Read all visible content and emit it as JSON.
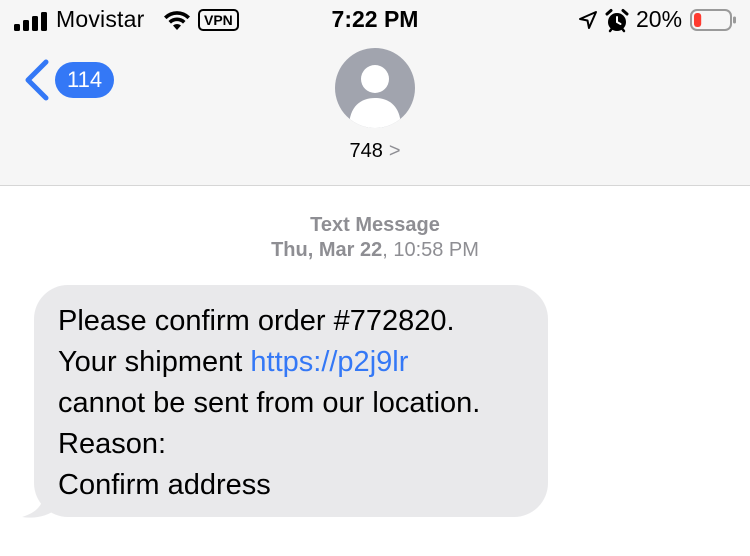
{
  "status_bar": {
    "carrier": "Movistar",
    "vpn": "VPN",
    "time": "7:22 PM",
    "battery_percent": "20%",
    "battery_level": 0.2,
    "battery_color": "#ff3b30"
  },
  "nav": {
    "back_count": "114",
    "contact": "748",
    "contact_chevron": ">"
  },
  "thread": {
    "message_type": "Text Message",
    "date": "Thu, Mar 22",
    "time": ", 10:58 PM"
  },
  "message": {
    "line1": "Please confirm order #772820.",
    "line2_prefix": "Your shipment ",
    "line2_link": "https://p2j9lr",
    "line3": "cannot be sent from our location.",
    "line4": "Reason:",
    "line5": "Confirm address"
  },
  "colors": {
    "accent": "#3478f6",
    "bubble": "#e9e9eb",
    "secondary_text": "#8e8e93"
  }
}
